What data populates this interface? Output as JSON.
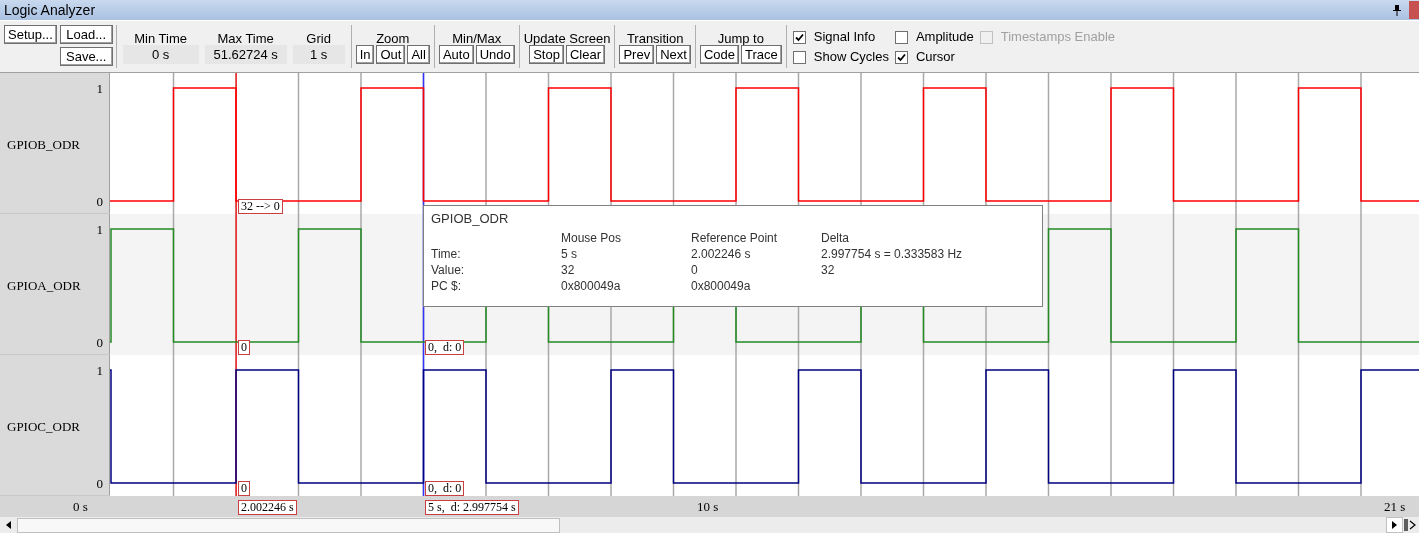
{
  "window": {
    "title": "Logic Analyzer"
  },
  "toolbar": {
    "file_buttons": [
      "Setup...",
      "Load...",
      "Save..."
    ],
    "readouts": [
      {
        "label": "Min Time",
        "value": "0 s"
      },
      {
        "label": "Max Time",
        "value": "51.62724 s"
      },
      {
        "label": "Grid",
        "value": "1 s"
      }
    ],
    "button_groups": [
      {
        "label": "Zoom",
        "buttons": [
          "In",
          "Out",
          "All"
        ]
      },
      {
        "label": "Min/Max",
        "buttons": [
          "Auto",
          "Undo"
        ]
      },
      {
        "label": "Update Screen",
        "buttons": [
          "Stop",
          "Clear"
        ]
      },
      {
        "label": "Transition",
        "buttons": [
          "Prev",
          "Next"
        ]
      },
      {
        "label": "Jump to",
        "buttons": [
          "Code",
          "Trace"
        ]
      }
    ],
    "checkboxes": [
      {
        "label": "Signal Info",
        "checked": true,
        "disabled": false
      },
      {
        "label": "Amplitude",
        "checked": false,
        "disabled": false
      },
      {
        "label": "Timestamps Enable",
        "checked": false,
        "disabled": true
      },
      {
        "label": "Show Cycles",
        "checked": false,
        "disabled": false
      },
      {
        "label": "Cursor",
        "checked": true,
        "disabled": false
      }
    ]
  },
  "signals": [
    {
      "name": "GPIOB_ODR",
      "color": "#ff0000",
      "high_label": "1",
      "low_label": "0",
      "reference_label": "32 --> 0"
    },
    {
      "name": "GPIOA_ODR",
      "color": "#228b22",
      "high_label": "1",
      "low_label": "0",
      "reference_label": "0",
      "cursor_label": "0,  d: 0"
    },
    {
      "name": "GPIOC_ODR",
      "color": "#000080",
      "high_label": "1",
      "low_label": "0",
      "reference_label": "0",
      "cursor_label": "0,  d: 0"
    }
  ],
  "axis": {
    "labels": [
      "0 s",
      "10 s",
      "21 s"
    ],
    "reference_time": "2.002246 s",
    "cursor_time": "5 s,  d: 2.997754 s"
  },
  "tooltip": {
    "title": "GPIOB_ODR",
    "columns": [
      "Mouse Pos",
      "Reference Point",
      "Delta"
    ],
    "rows": [
      {
        "label": "Time:",
        "values": [
          "5 s",
          "2.002246 s",
          "2.997754 s = 0.333583 Hz"
        ]
      },
      {
        "label": "Value:",
        "values": [
          "32",
          "0",
          "32"
        ]
      },
      {
        "label": "PC $:",
        "values": [
          "0x800049a",
          "0x800049a"
        ]
      }
    ]
  }
}
